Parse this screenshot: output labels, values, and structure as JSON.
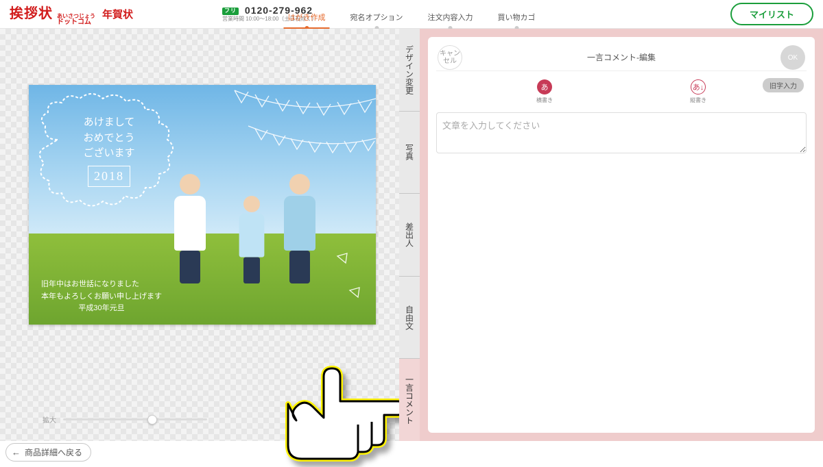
{
  "header": {
    "logo_main": "挨拶状",
    "logo_ruby": "あいさつじょう",
    "logo_dotcom": "ドットコム",
    "logo_sub": "年賀状",
    "phone_free": "フリ",
    "phone_number": "0120-279-962",
    "phone_hours": "営業時間 10:00～18:00（土日祝除く）",
    "mylist": "マイリスト"
  },
  "steps": [
    {
      "label": "はがき作成",
      "active": true
    },
    {
      "label": "宛名オプション",
      "active": false
    },
    {
      "label": "注文内容入力",
      "active": false
    },
    {
      "label": "買い物カゴ",
      "active": false
    }
  ],
  "side_tabs": [
    {
      "label": "デザイン変更",
      "active": false
    },
    {
      "label": "写真",
      "active": false
    },
    {
      "label": "差出人",
      "active": false
    },
    {
      "label": "自由文",
      "active": false
    },
    {
      "label": "一言コメント",
      "active": true
    }
  ],
  "canvas": {
    "greeting_line1": "あけまして",
    "greeting_line2": "おめでとう",
    "greeting_line3": "ございます",
    "greeting_year": "2018",
    "footer_line1": "旧年中はお世話になりました",
    "footer_line2": "本年もよろしくお願い申し上げます",
    "footer_line3": "平成30年元旦",
    "zoom_label": "拡大"
  },
  "editor": {
    "cancel": "キャン\nセル",
    "ok": "OK",
    "title": "一言コメント-編集",
    "orient_h_glyph": "あ",
    "orient_h_label": "横書き",
    "orient_v_glyph": "あ↓",
    "orient_v_label": "縦書き",
    "oldchar": "旧字入力",
    "placeholder": "文章を入力してください"
  },
  "back_button": "商品詳細へ戻る"
}
